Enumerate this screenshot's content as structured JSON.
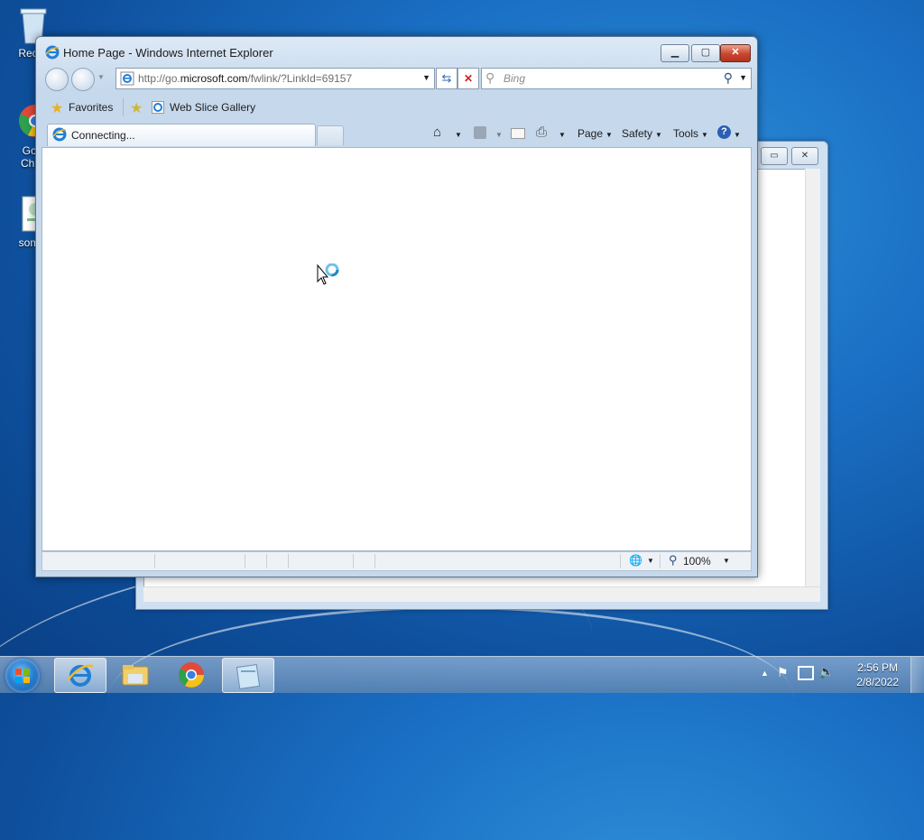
{
  "desktop": {
    "icons": [
      {
        "label": "Recyc",
        "icon": "recycle-bin-icon"
      },
      {
        "label": "Goo Chro",
        "icon": "chrome-icon"
      },
      {
        "label": "somet",
        "icon": "document-icon"
      }
    ]
  },
  "ie": {
    "title": "Home Page - Windows Internet Explorer",
    "address": {
      "prefix": "http://go.",
      "domain": "microsoft.com",
      "suffix": "/fwlink/?LinkId=69157"
    },
    "search_placeholder": "Bing",
    "favorites_label": "Favorites",
    "web_slice_label": "Web Slice Gallery",
    "tab_label": "Connecting...",
    "commands": {
      "page": "Page",
      "safety": "Safety",
      "tools": "Tools"
    },
    "zoom": "100%"
  },
  "taskbar": {
    "apps": [
      "internet-explorer",
      "windows-explorer",
      "chrome",
      "notepad"
    ],
    "time": "2:56 PM",
    "date": "2/8/2022"
  }
}
